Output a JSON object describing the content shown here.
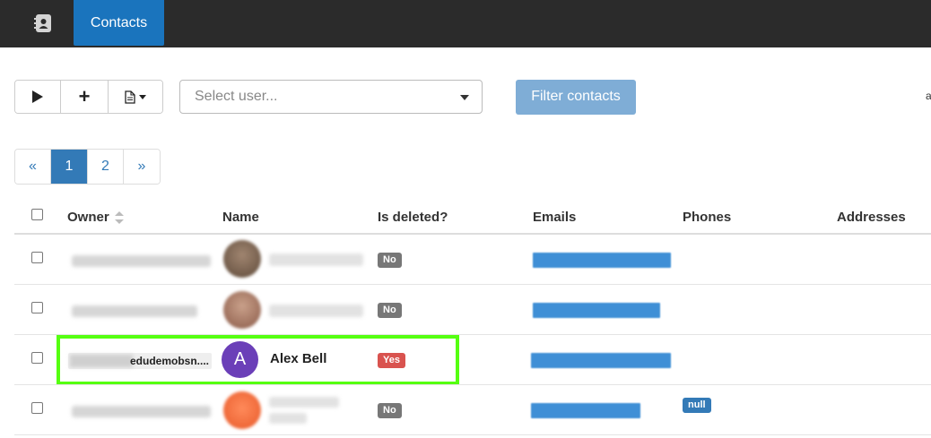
{
  "topbar": {
    "icon": "contacts-book-icon",
    "tab_label": "Contacts"
  },
  "toolbar": {
    "play_icon": "play-icon",
    "add_icon": "plus-icon",
    "add_label": "+",
    "export_icon": "document-icon",
    "select_user_placeholder": "Select user...",
    "filter_label": "Filter contacts",
    "edge_text": "a"
  },
  "pagination": {
    "prev": "«",
    "pages": [
      "1",
      "2"
    ],
    "active_page": "1",
    "next": "»"
  },
  "table": {
    "headers": {
      "owner": "Owner",
      "name": "Name",
      "is_deleted": "Is deleted?",
      "emails": "Emails",
      "phones": "Phones",
      "addresses": "Addresses"
    },
    "rows": [
      {
        "is_deleted": "No",
        "phones": ""
      },
      {
        "is_deleted": "No",
        "phones": ""
      },
      {
        "owner": "edudemobsn....",
        "avatar_letter": "A",
        "name": "Alex Bell",
        "is_deleted": "Yes",
        "phones": ""
      },
      {
        "is_deleted": "No",
        "phones": "null"
      }
    ]
  },
  "colors": {
    "topbar_bg": "#2b2b2b",
    "active_tab": "#1a74bd",
    "filter_button": "#7fadd6",
    "page_active": "#337ab7",
    "badge_no": "#777777",
    "badge_yes": "#d9534f",
    "badge_null": "#337ab7",
    "avatar": "#6b3fb8",
    "highlight": "#55ff11"
  }
}
